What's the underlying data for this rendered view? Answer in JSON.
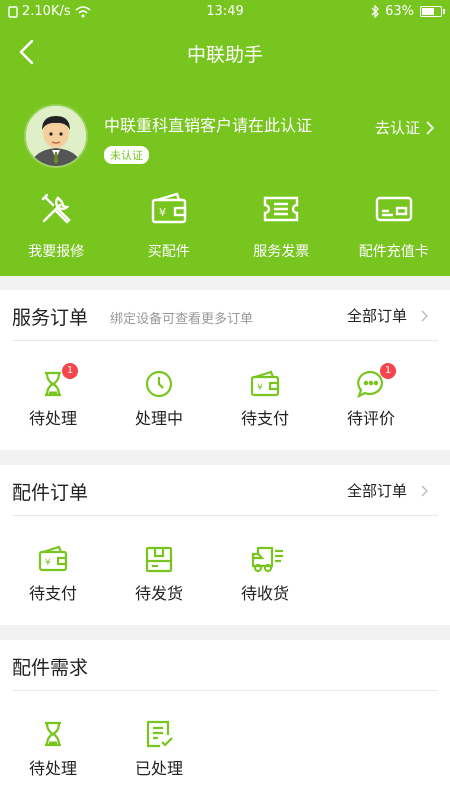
{
  "status_bar": {
    "speed": "2.10K/s",
    "time": "13:49",
    "battery": "63%"
  },
  "nav": {
    "title": "中联助手"
  },
  "profile": {
    "name": "中联重科直销客户请在此认证",
    "badge": "未认证",
    "verify_label": "去认证"
  },
  "quick_actions": [
    {
      "label": "我要报修",
      "icon": "tools-icon"
    },
    {
      "label": "买配件",
      "icon": "wallet-icon"
    },
    {
      "label": "服务发票",
      "icon": "ticket-icon"
    },
    {
      "label": "配件充值卡",
      "icon": "card-icon"
    }
  ],
  "service_orders": {
    "title": "服务订单",
    "subtitle": "绑定设备可查看更多订单",
    "all_label": "全部订单",
    "items": [
      {
        "label": "待处理",
        "icon": "hourglass-icon",
        "badge": "1"
      },
      {
        "label": "处理中",
        "icon": "clock-icon",
        "badge": ""
      },
      {
        "label": "待支付",
        "icon": "wallet-icon",
        "badge": ""
      },
      {
        "label": "待评价",
        "icon": "chat-icon",
        "badge": "1"
      }
    ]
  },
  "parts_orders": {
    "title": "配件订单",
    "all_label": "全部订单",
    "items": [
      {
        "label": "待支付",
        "icon": "wallet-icon"
      },
      {
        "label": "待发货",
        "icon": "box-icon"
      },
      {
        "label": "待收货",
        "icon": "truck-icon"
      }
    ]
  },
  "parts_demand": {
    "title": "配件需求",
    "items": [
      {
        "label": "待处理",
        "icon": "hourglass-icon"
      },
      {
        "label": "已处理",
        "icon": "checklist-icon"
      }
    ]
  },
  "colors": {
    "brand": "#78c51f",
    "badge": "#f5454a"
  }
}
